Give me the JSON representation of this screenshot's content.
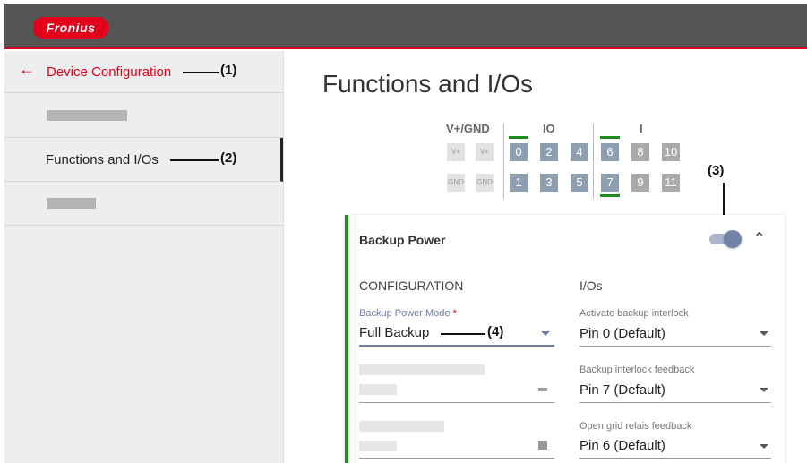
{
  "header": {
    "logo_text": "Fronius"
  },
  "sidebar": {
    "back_label": "Device Configuration",
    "active_item": "Functions and I/Os"
  },
  "callouts": {
    "c1": "(1)",
    "c2": "(2)",
    "c3": "(3)",
    "c4": "(4)"
  },
  "main": {
    "title": "Functions and I/Os",
    "io_diagram": {
      "groups": [
        "V+/GND",
        "IO",
        "I"
      ],
      "power_top": [
        "V+",
        "V+"
      ],
      "power_bottom": [
        "GND",
        "GND"
      ],
      "io_top": [
        "0",
        "2",
        "4"
      ],
      "io_bottom": [
        "1",
        "3",
        "5"
      ],
      "in_top": [
        "6",
        "8",
        "10"
      ],
      "in_bottom": [
        "7",
        "9",
        "11"
      ]
    },
    "card": {
      "title": "Backup Power",
      "toggle_state": "on",
      "configuration": {
        "heading": "CONFIGURATION",
        "mode_label": "Backup Power Mode",
        "required_mark": "*",
        "mode_value": "Full Backup"
      },
      "ios": {
        "heading": "I/Os",
        "fields": [
          {
            "label": "Activate backup interlock",
            "value": "Pin 0 (Default)"
          },
          {
            "label": "Backup interlock feedback",
            "value": "Pin 7 (Default)"
          },
          {
            "label": "Open grid relais feedback",
            "value": "Pin 6 (Default)"
          }
        ]
      }
    }
  },
  "colors": {
    "brand_red": "#e2001a",
    "active_green": "#1f8b1f",
    "accent_blue": "#6c7ea3",
    "io_blue": "#8e9fb2"
  }
}
